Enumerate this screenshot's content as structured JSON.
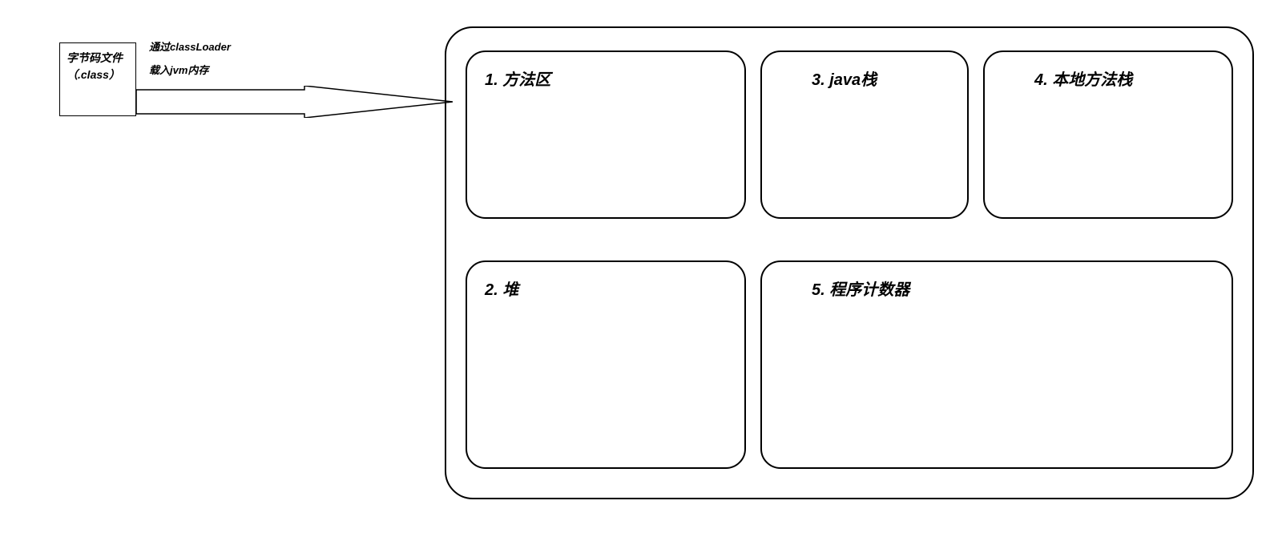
{
  "classFile": {
    "label": "字节码文件（.class）"
  },
  "arrow": {
    "line1": "通过classLoader",
    "line2": "载入jvm内存"
  },
  "jvm": {
    "methodArea": "1. 方法区",
    "heap": "2. 堆",
    "javaStack": "3. java栈",
    "nativeStack": "4. 本地方法栈",
    "pcRegister": "5. 程序计数器"
  }
}
